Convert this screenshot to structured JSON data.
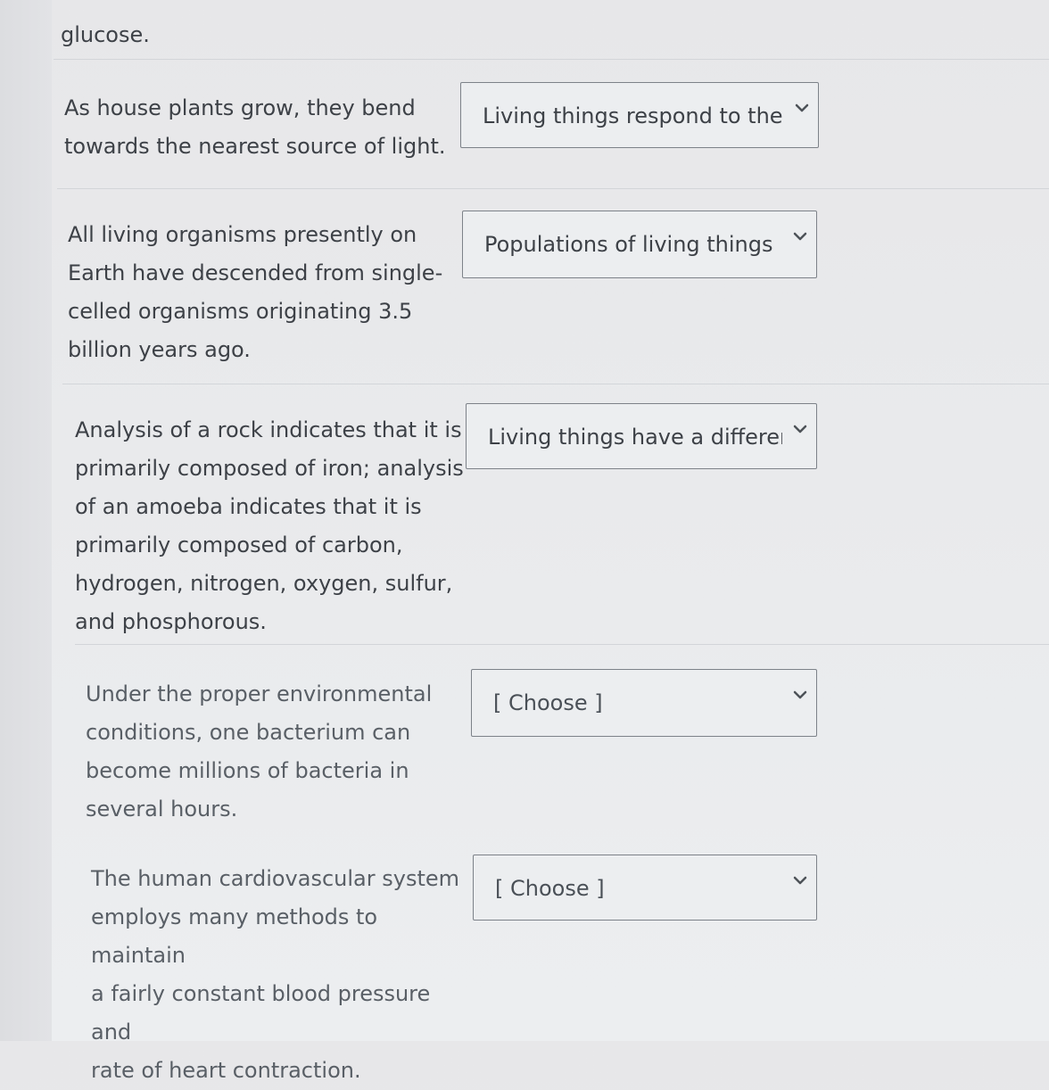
{
  "intro": {
    "text": "glucose."
  },
  "questions": [
    {
      "lines": [
        "As house plants grow, they bend",
        "towards the nearest source of light."
      ],
      "answer": "Living things respond to the"
    },
    {
      "lines": [
        "All living organisms presently on",
        "Earth have descended from single-",
        "celled organisms originating 3.5",
        "billion years ago."
      ],
      "answer": "Populations of living things"
    },
    {
      "lines": [
        "Analysis of a rock indicates that it is",
        "primarily composed of iron; analysis",
        "of an amoeba indicates that it is",
        "primarily composed of carbon,",
        "hydrogen, nitrogen, oxygen, sulfur,",
        "and phosphorous."
      ],
      "answer": "Living things have a differer"
    },
    {
      "lines": [
        "Under the proper environmental",
        "conditions, one bacterium can",
        "become millions of bacteria in",
        "several hours."
      ],
      "answer": "[ Choose ]"
    },
    {
      "lines": [
        "The human cardiovascular system",
        "employs many methods to maintain",
        "a fairly constant blood pressure and",
        "rate of heart contraction."
      ],
      "answer": "[ Choose ]"
    }
  ],
  "icons": {
    "dropdown": "chevron-down-icon"
  },
  "colors": {
    "text": "#3d4147",
    "border": "#7d8289",
    "divider": "#d3d5d9",
    "background": "#eceef0"
  }
}
